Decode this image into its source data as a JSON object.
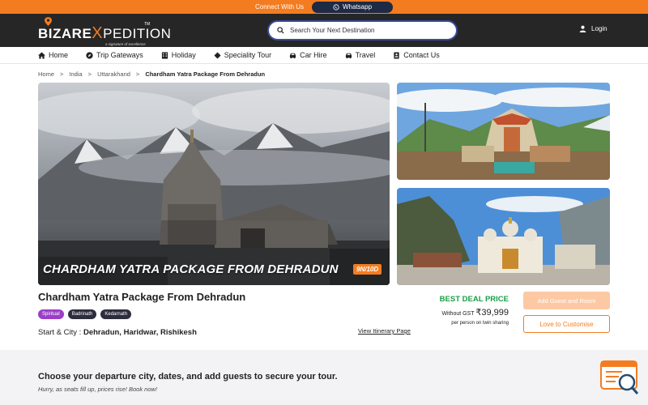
{
  "topbar": {
    "connect_text": "Connect With Us",
    "whatsapp_label": "Whatsapp"
  },
  "header": {
    "logo": {
      "bizare": "BIZARE",
      "x": "X",
      "pedition": "PEDITION",
      "tagline": "a signature of excellence",
      "tm": "TM"
    },
    "search_placeholder": "Search Your Next Destination",
    "login_label": "Login"
  },
  "nav": {
    "items": [
      {
        "label": "Home",
        "icon": "home-icon"
      },
      {
        "label": "Trip Gateways",
        "icon": "compass-icon"
      },
      {
        "label": "Holiday",
        "icon": "hotel-icon"
      },
      {
        "label": "Speciality Tour",
        "icon": "diamond-icon"
      },
      {
        "label": "Car Hire",
        "icon": "car-icon"
      },
      {
        "label": "Travel",
        "icon": "car-icon"
      },
      {
        "label": "Contact Us",
        "icon": "contact-icon"
      }
    ]
  },
  "breadcrumb": {
    "items": [
      "Home",
      "India",
      "Uttarakhand"
    ],
    "separator": ">",
    "current": "Chardham Yatra Package From Dehradun"
  },
  "hero": {
    "overlay_title": "CHARDHAM YATRA PACKAGE FROM DEHRADUN",
    "duration": "9N/10D"
  },
  "package": {
    "title": "Chardham Yatra Package From Dehradun",
    "tags": [
      "Spiritual",
      "Badrinath",
      "Kedarnath"
    ],
    "start_city_label": "Start & City :",
    "start_city_value": "Dehradun, Haridwar, Rishikesh",
    "itinerary_link": "View Itinerary Page"
  },
  "pricing": {
    "deal_label": "BEST DEAL PRICE",
    "without_gst": "Without GST",
    "price": "₹39,999",
    "per_person": "per person on twin sharing",
    "add_button": "Add Guest and Room",
    "customise_button": "Love to Customise"
  },
  "bottom": {
    "title": "Choose your departure city, dates, and add guests to secure your tour.",
    "subtitle": "Hurry, as seats fill up, prices rise! Book now!"
  },
  "colors": {
    "brand_orange": "#f47c20",
    "header_dark": "#262626",
    "deal_green": "#1a9e45",
    "search_border": "#3a4a9c"
  }
}
